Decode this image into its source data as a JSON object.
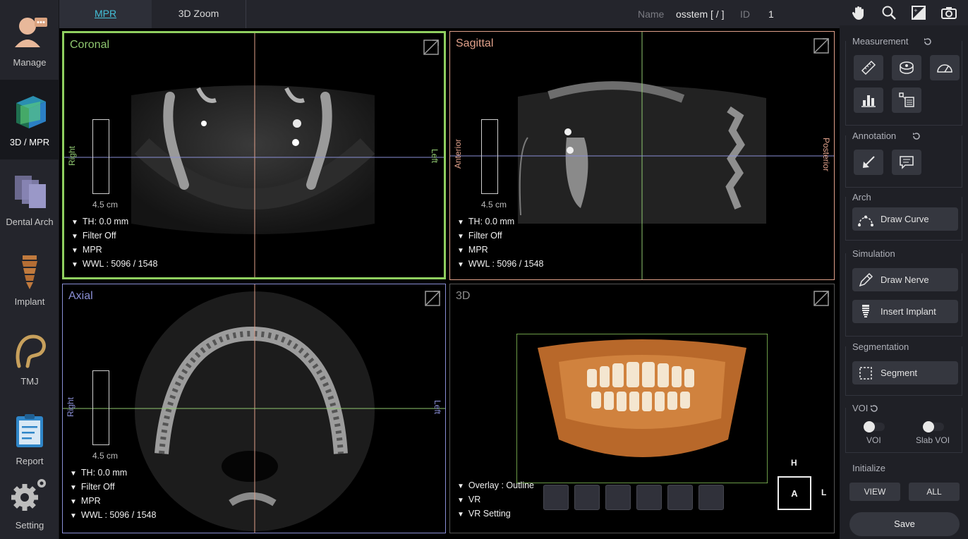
{
  "nav": {
    "items": [
      {
        "label": "Manage"
      },
      {
        "label": "3D / MPR"
      },
      {
        "label": "Dental Arch"
      },
      {
        "label": "Implant"
      },
      {
        "label": "TMJ"
      },
      {
        "label": "Report"
      },
      {
        "label": "Setting"
      }
    ]
  },
  "tabs": [
    {
      "label": "MPR"
    },
    {
      "label": "3D Zoom"
    }
  ],
  "patient": {
    "name_label": "Name",
    "name_value": "osstem [ / ]",
    "id_label": "ID",
    "id_value": "1"
  },
  "views": {
    "coronal": {
      "title": "Coronal",
      "left_side": "Right",
      "right_side": "Left",
      "ruler": "4.5 cm",
      "info": [
        "TH: 0.0 mm",
        "Filter Off",
        "MPR",
        "WWL : 5096 / 1548"
      ]
    },
    "sagittal": {
      "title": "Sagittal",
      "left_side": "Anterior",
      "right_side": "Posterior",
      "ruler": "4.5 cm",
      "info": [
        "TH: 0.0 mm",
        "Filter Off",
        "MPR",
        "WWL : 5096 / 1548"
      ]
    },
    "axial": {
      "title": "Axial",
      "left_side": "Right",
      "right_side": "Left",
      "ruler": "4.5 cm",
      "info": [
        "TH: 0.0 mm",
        "Filter Off",
        "MPR",
        "WWL : 5096 / 1548"
      ]
    },
    "three_d": {
      "title": "3D",
      "info": [
        "Overlay : Outline",
        "VR",
        "VR Setting"
      ],
      "orient": {
        "top": "H",
        "center": "A",
        "right": "L"
      }
    }
  },
  "panel": {
    "measurement": {
      "title": "Measurement"
    },
    "annotation": {
      "title": "Annotation"
    },
    "arch": {
      "title": "Arch",
      "draw_curve": "Draw Curve"
    },
    "simulation": {
      "title": "Simulation",
      "draw_nerve": "Draw Nerve",
      "insert_implant": "Insert Implant"
    },
    "segmentation": {
      "title": "Segmentation",
      "segment": "Segment"
    },
    "voi": {
      "title": "VOI",
      "voi_label": "VOI",
      "slab_label": "Slab VOI"
    },
    "initialize": {
      "title": "Initialize",
      "view": "VIEW",
      "all": "ALL"
    },
    "save": "Save"
  },
  "colors": {
    "accent": "#44c0d8",
    "coronal": "#8fc870",
    "sagittal": "#e0a08a",
    "axial": "#8a8fd6",
    "three_d": "#8c8c8c",
    "active_border": "#8fcf5f"
  }
}
